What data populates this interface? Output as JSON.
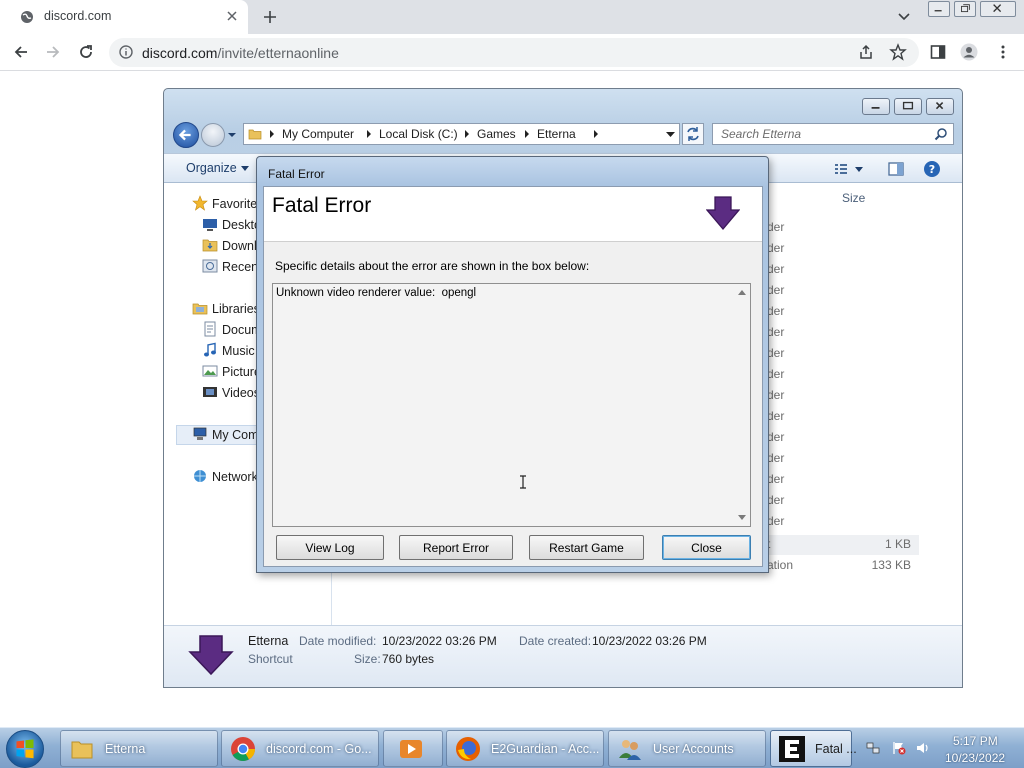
{
  "browser": {
    "tab_title": "discord.com",
    "url_host": "discord.com",
    "url_path": "/invite/etternaonline"
  },
  "explorer": {
    "breadcrumbs": [
      "My Computer",
      "Local Disk (C:)",
      "Games",
      "Etterna"
    ],
    "search_placeholder": "Search Etterna",
    "organize_label": "Organize",
    "nav": {
      "favorites": "Favorite",
      "desktop": "Deskto",
      "downloads": "Downl",
      "recent": "Recen",
      "libraries": "Libraries",
      "documents": "Docum",
      "music": "Music",
      "pictures": "Picture",
      "videos": "Videos",
      "computer": "My Com",
      "network": "Network"
    },
    "column_size": "Size",
    "partial_rows": [
      "der",
      "der",
      "der",
      "der",
      "der",
      "der",
      "der",
      "der",
      "der",
      "der",
      "der",
      "der",
      "der",
      "der",
      "der"
    ],
    "row_t_partial": "t",
    "row_t_size": "1 KB",
    "row_ation_partial": "ation",
    "row_ation_size": "133 KB",
    "status": {
      "name": "Etterna",
      "type": "Shortcut",
      "date_modified_label": "Date modified:",
      "date_modified": "10/23/2022 03:26 PM",
      "date_created_label": "Date created:",
      "date_created": "10/23/2022 03:26 PM",
      "size_label": "Size:",
      "size": "760 bytes"
    }
  },
  "dialog": {
    "title": "Fatal Error",
    "heading": "Fatal Error",
    "description": "Specific details about the error are shown in the box below:",
    "details": "Unknown video renderer value:  opengl",
    "buttons": {
      "view_log": "View Log",
      "report_error": "Report Error",
      "restart_game": "Restart Game",
      "close": "Close"
    }
  },
  "taskbar": {
    "items": [
      "Etterna",
      "discord.com - Go...",
      "E2Guardian - Acc...",
      "User Accounts",
      "Fatal ..."
    ],
    "time": "5:17 PM",
    "date": "10/23/2022"
  },
  "colors": {
    "logo_purple": "#5b2c82",
    "chrome_tabstrip": "#dee1e6"
  }
}
